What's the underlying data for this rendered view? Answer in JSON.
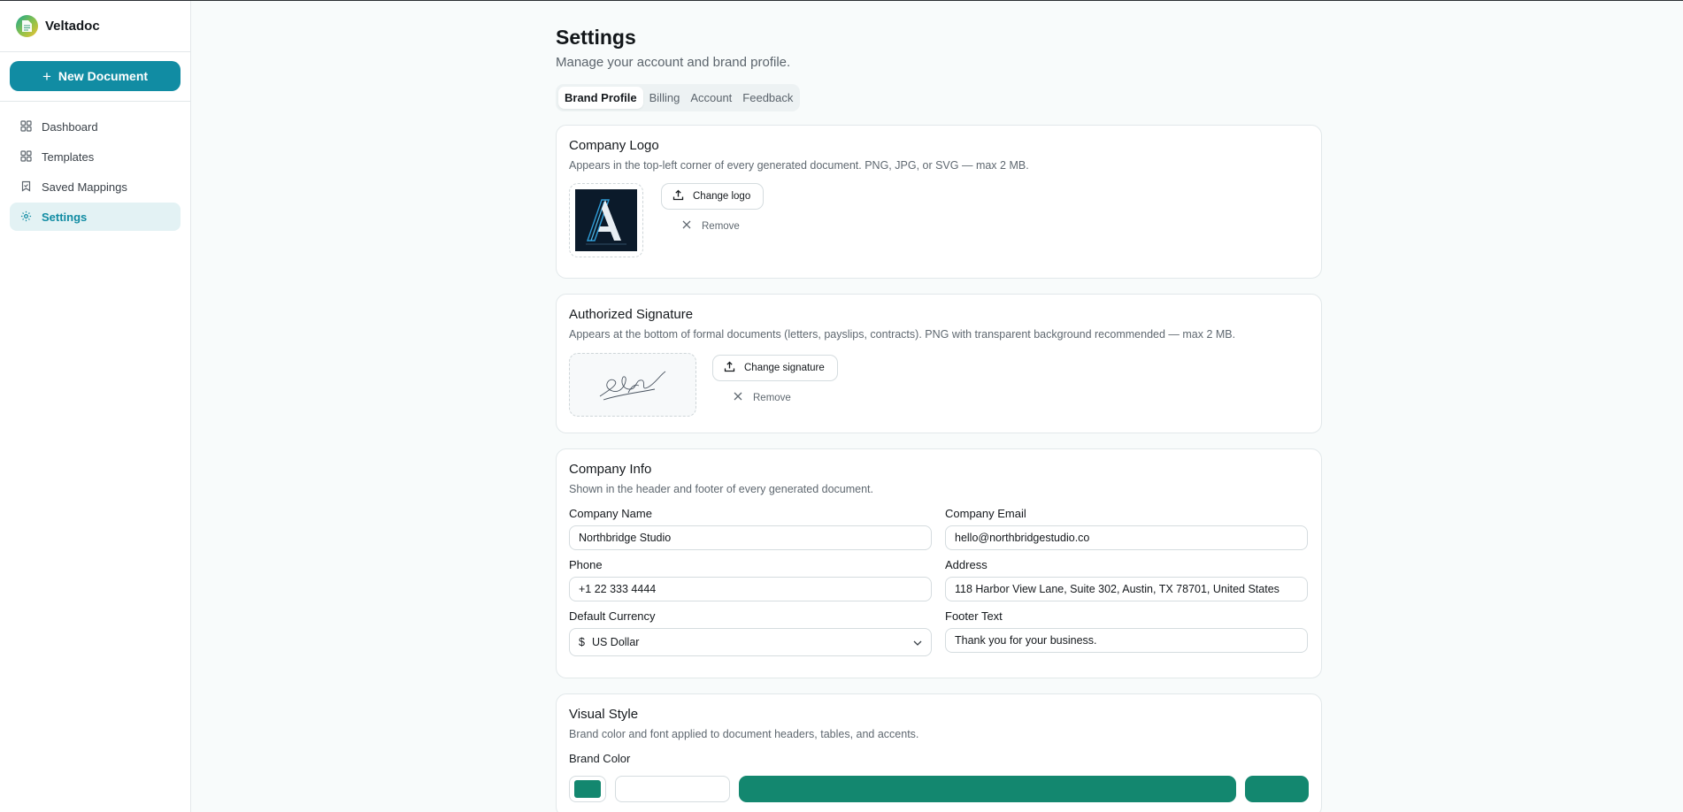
{
  "app": {
    "name": "Veltadoc"
  },
  "sidebar": {
    "new_doc_label": "New Document",
    "items": [
      {
        "label": "Dashboard",
        "icon": "grid-icon",
        "active": false
      },
      {
        "label": "Templates",
        "icon": "grid-icon",
        "active": false
      },
      {
        "label": "Saved Mappings",
        "icon": "bookmark-icon",
        "active": false
      },
      {
        "label": "Settings",
        "icon": "gear-icon",
        "active": true
      }
    ]
  },
  "page": {
    "title": "Settings",
    "subtitle": "Manage your account and brand profile.",
    "tabs": [
      "Brand Profile",
      "Billing",
      "Account",
      "Feedback"
    ],
    "active_tab": "Brand Profile"
  },
  "logo_card": {
    "title": "Company Logo",
    "desc": "Appears in the top-left corner of every generated document. PNG, JPG, or SVG — max 2 MB.",
    "change_label": "Change logo",
    "remove_label": "Remove"
  },
  "signature_card": {
    "title": "Authorized Signature",
    "desc": "Appears at the bottom of formal documents (letters, payslips, contracts). PNG with transparent background recommended — max 2 MB.",
    "change_label": "Change signature",
    "remove_label": "Remove"
  },
  "info_card": {
    "title": "Company Info",
    "desc": "Shown in the header and footer of every generated document.",
    "fields": {
      "company_name": {
        "label": "Company Name",
        "value": "Northbridge Studio"
      },
      "company_email": {
        "label": "Company Email",
        "value": "hello@northbridgestudio.co"
      },
      "phone": {
        "label": "Phone",
        "value": "+1 22 333 4444"
      },
      "address": {
        "label": "Address",
        "value": "118 Harbor View Lane, Suite 302, Austin, TX 78701, United States"
      },
      "currency": {
        "label": "Default Currency",
        "symbol": "$",
        "value": "US Dollar"
      },
      "footer_text": {
        "label": "Footer Text",
        "value": "Thank you for your business."
      }
    }
  },
  "visual_card": {
    "title": "Visual Style",
    "desc": "Brand color and font applied to document headers, tables, and accents.",
    "brand_color_label": "Brand Color"
  },
  "colors": {
    "accent": "#118ca3",
    "brand": "#13876f",
    "nav_active_bg": "#e3f2f4"
  }
}
